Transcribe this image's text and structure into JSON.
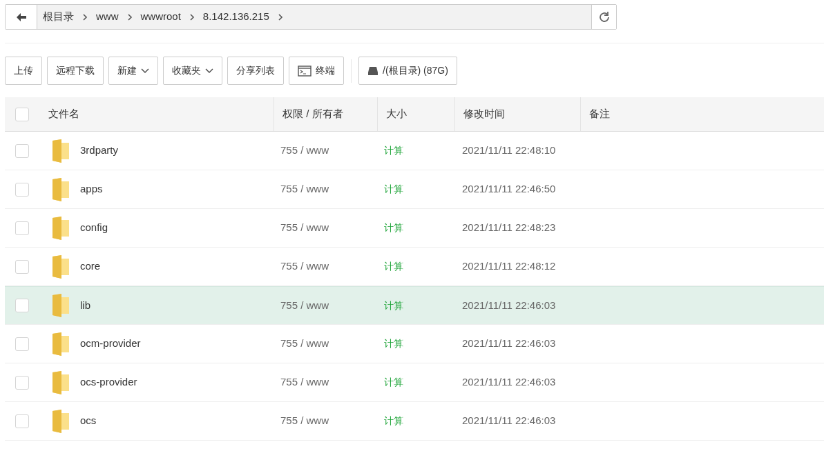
{
  "breadcrumb": {
    "segments": [
      "根目录",
      "www",
      "wwwroot",
      "8.142.136.215"
    ]
  },
  "toolbar": [
    {
      "kind": "plain",
      "label": "上传"
    },
    {
      "kind": "plain",
      "label": "远程下载"
    },
    {
      "kind": "dropdown",
      "label": "新建"
    },
    {
      "kind": "dropdown",
      "label": "收藏夹"
    },
    {
      "kind": "plain",
      "label": "分享列表"
    },
    {
      "kind": "terminal",
      "label": "终端"
    },
    {
      "kind": "disk",
      "label": "/(根目录) (87G)"
    }
  ],
  "table": {
    "select_all_checked": false,
    "columns": [
      "文件名",
      "权限 / 所有者",
      "大小",
      "修改时间",
      "备注"
    ],
    "rows": [
      {
        "name": "3rdparty",
        "permission": "755 / www",
        "size": "计算",
        "modified": "2021/11/11 22:48:10",
        "checked": false,
        "highlighted": false
      },
      {
        "name": "apps",
        "permission": "755 / www",
        "size": "计算",
        "modified": "2021/11/11 22:46:50",
        "checked": false,
        "highlighted": false
      },
      {
        "name": "config",
        "permission": "755 / www",
        "size": "计算",
        "modified": "2021/11/11 22:48:23",
        "checked": false,
        "highlighted": false
      },
      {
        "name": "core",
        "permission": "755 / www",
        "size": "计算",
        "modified": "2021/11/11 22:48:12",
        "checked": false,
        "highlighted": false
      },
      {
        "name": "lib",
        "permission": "755 / www",
        "size": "计算",
        "modified": "2021/11/11 22:46:03",
        "checked": false,
        "highlighted": true
      },
      {
        "name": "ocm-provider",
        "permission": "755 / www",
        "size": "计算",
        "modified": "2021/11/11 22:46:03",
        "checked": false,
        "highlighted": false
      },
      {
        "name": "ocs-provider",
        "permission": "755 / www",
        "size": "计算",
        "modified": "2021/11/11 22:46:03",
        "checked": false,
        "highlighted": false
      },
      {
        "name": "ocs",
        "permission": "755 / www",
        "size": "计算",
        "modified": "2021/11/11 22:46:03",
        "checked": false,
        "highlighted": false
      }
    ]
  }
}
